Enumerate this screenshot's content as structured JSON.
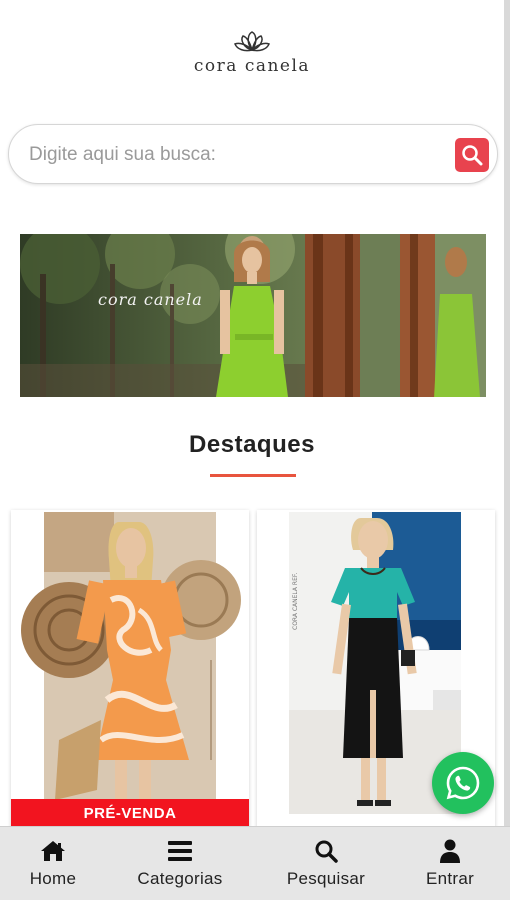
{
  "brand": {
    "logo_text": "cora canela"
  },
  "search": {
    "placeholder": "Digite aqui sua busca:",
    "value": ""
  },
  "banner": {
    "text": "cora canela"
  },
  "section": {
    "title": "Destaques"
  },
  "products": [
    {
      "badge": "PRÉ-VENDA"
    },
    {
      "badge": ""
    }
  ],
  "bottom_nav": [
    {
      "label": "Home",
      "icon": "home-icon"
    },
    {
      "label": "Categorias",
      "icon": "menu-icon"
    },
    {
      "label": "Pesquisar",
      "icon": "search-icon"
    },
    {
      "label": "Entrar",
      "icon": "user-icon"
    }
  ],
  "colors": {
    "accent_red": "#e8434e",
    "badge_red": "#f2141f",
    "underline": "#e8543e",
    "whatsapp_green": "#22c15e",
    "nav_bg": "#e6e6e6"
  }
}
